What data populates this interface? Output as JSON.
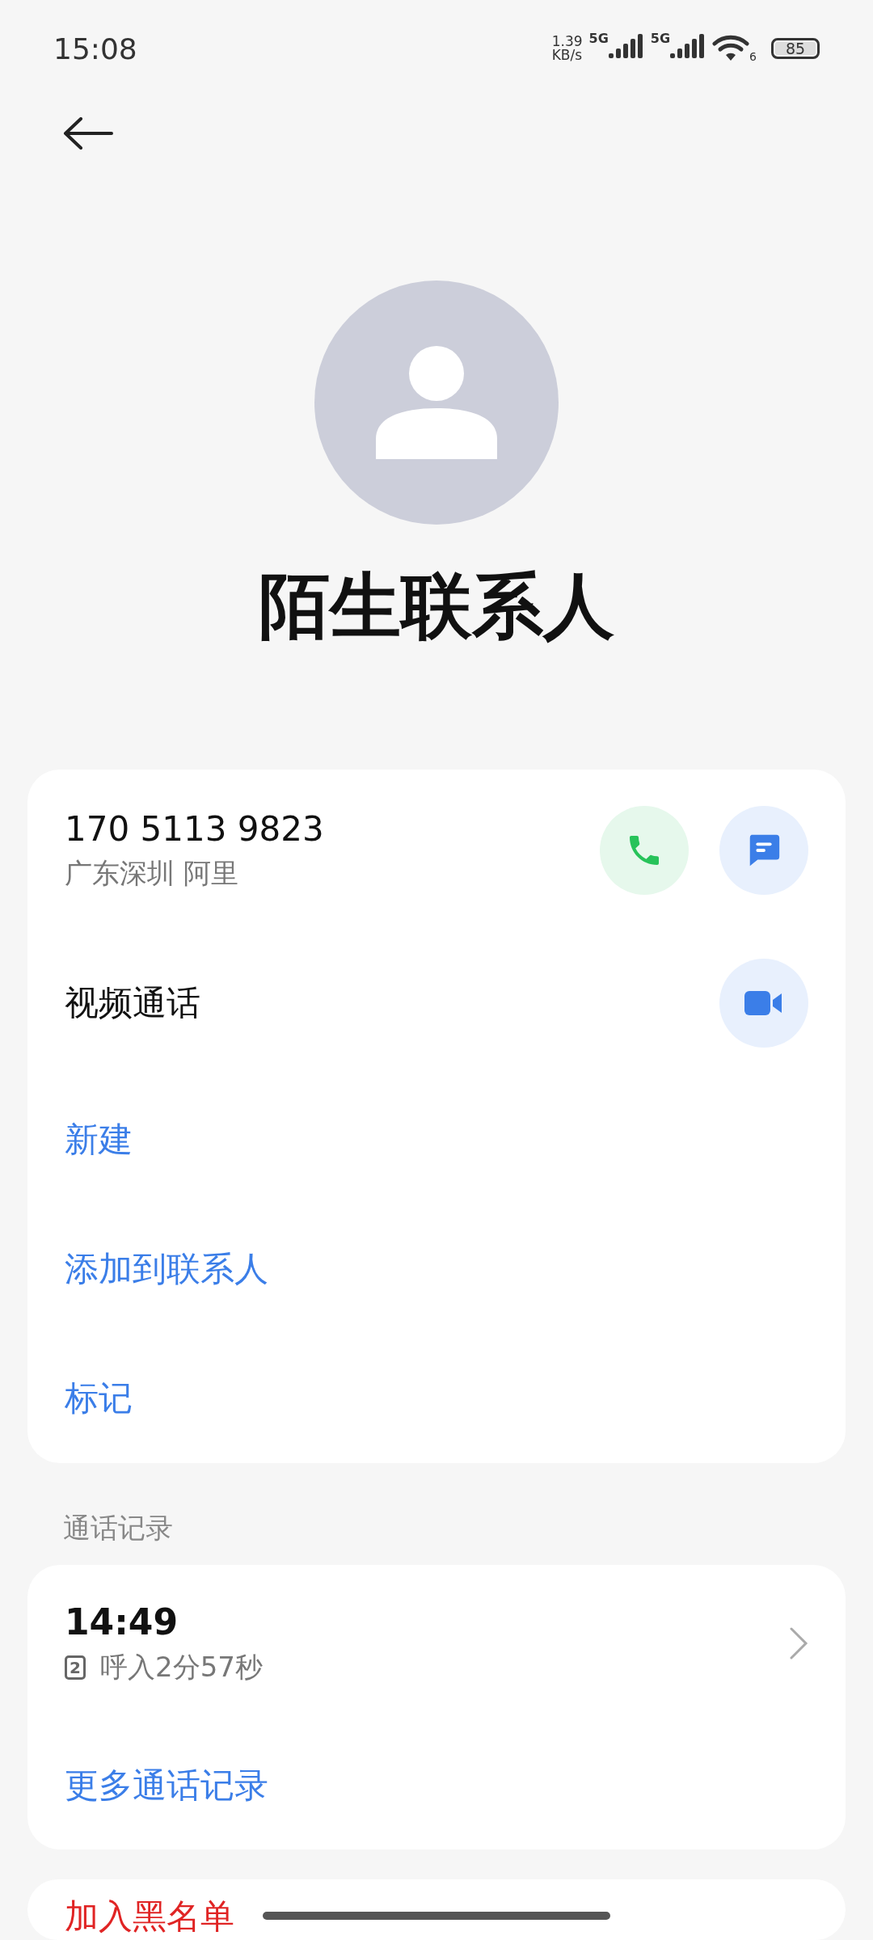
{
  "status_bar": {
    "time": "15:08",
    "net_speed_value": "1.39",
    "net_speed_unit": "KB/s",
    "sim1_network": "5G",
    "sim2_network": "5G",
    "wifi_label": "6",
    "battery": "85"
  },
  "contact": {
    "name": "陌生联系人"
  },
  "number_card": {
    "number": "170 5113 9823",
    "location": "广东深圳 阿里",
    "video_call": "视频通话",
    "actions": [
      {
        "label": "新建"
      },
      {
        "label": "添加到联系人"
      },
      {
        "label": "标记"
      }
    ]
  },
  "call_log": {
    "title": "通话记录",
    "entries": [
      {
        "time": "14:49",
        "sim": "2",
        "detail": "呼入2分57秒"
      }
    ],
    "more": "更多通话记录"
  },
  "block_card": {
    "label": "加入黑名单"
  }
}
